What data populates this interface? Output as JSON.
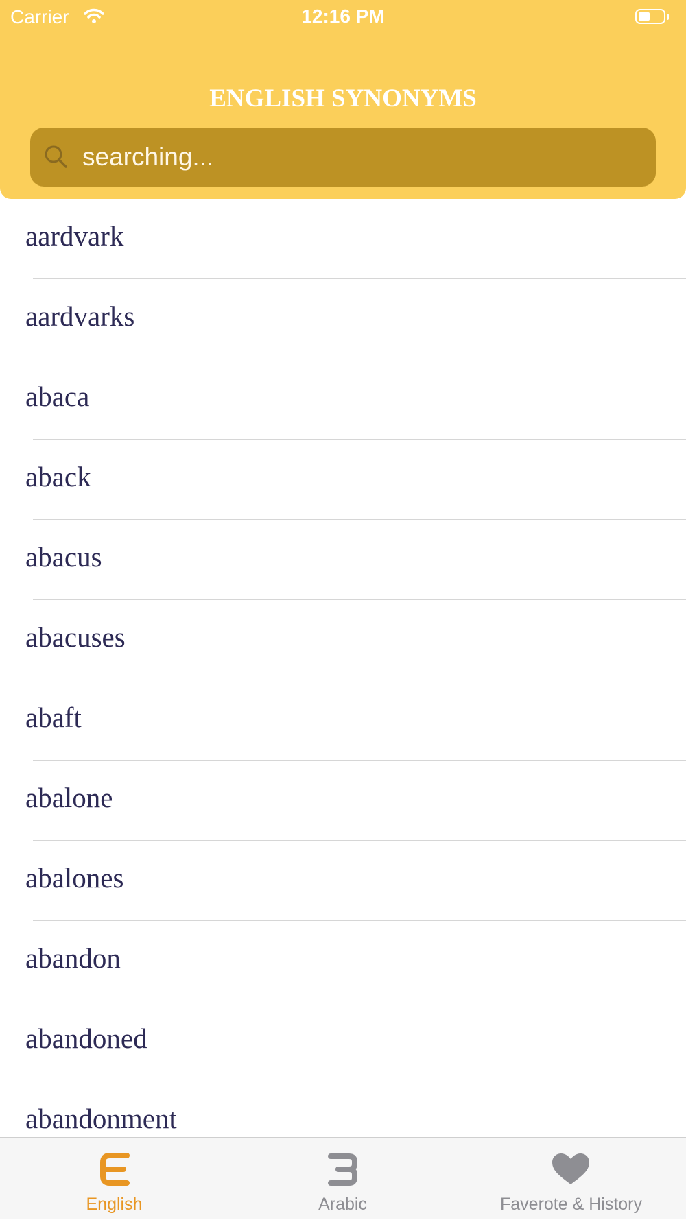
{
  "status_bar": {
    "carrier": "Carrier",
    "time": "12:16 PM"
  },
  "header": {
    "title": "ENGLISH SYNONYMS"
  },
  "search": {
    "placeholder": "searching..."
  },
  "words": [
    "aardvark",
    "aardvarks",
    "abaca",
    "aback",
    "abacus",
    "abacuses",
    "abaft",
    "abalone",
    "abalones",
    "abandon",
    "abandoned",
    "abandonment"
  ],
  "tabs": [
    {
      "label": "English",
      "icon": "english-letter-icon",
      "active": true
    },
    {
      "label": "Arabic",
      "icon": "arabic-letter-icon",
      "active": false
    },
    {
      "label": "Faverote & History",
      "icon": "heart-icon",
      "active": false
    }
  ],
  "colors": {
    "header_bg": "#fbcf5a",
    "search_bg": "#bd9224",
    "active_tab": "#e89623",
    "inactive_tab": "#8e8e93",
    "word_text": "#2d2a55"
  }
}
